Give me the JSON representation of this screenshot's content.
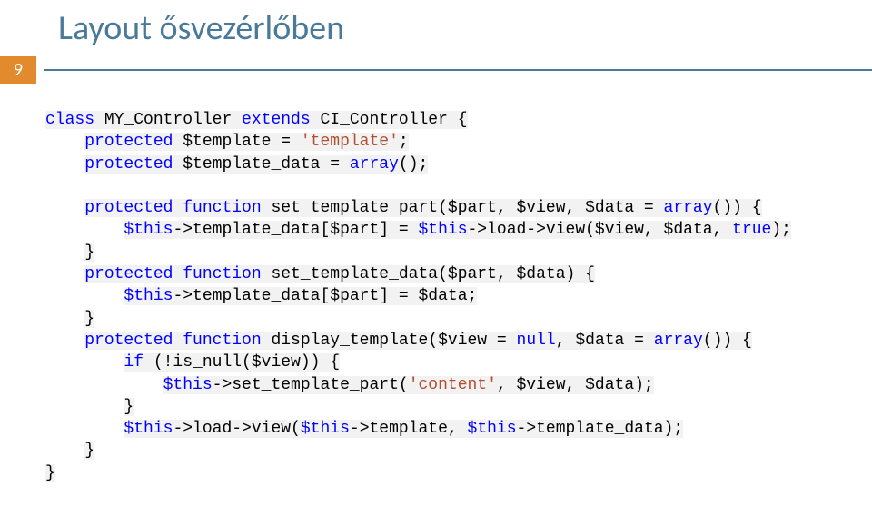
{
  "title": "Layout ősvezérlőben",
  "page_number": "9",
  "code": {
    "l1_a": "class",
    "l1_b": " MY_Controller ",
    "l1_c": "extends",
    "l1_d": " CI_Controller {",
    "l2_a": "protected",
    "l2_b": " $template = ",
    "l2_c": "'template'",
    "l2_d": ";",
    "l3_a": "protected",
    "l3_b": " $template_data = ",
    "l3_c": "array",
    "l3_d": "();",
    "l5_a": "protected function",
    "l5_b": " set_template_part($part, $view, $data = ",
    "l5_c": "array",
    "l5_d": "()) {",
    "l6_a": "$this",
    "l6_b": "->template_data[$part] = ",
    "l6_c": "$this",
    "l6_d": "->load->view($view, $data, ",
    "l6_e": "true",
    "l6_f": ");",
    "l7": "}",
    "l8_a": "protected function",
    "l8_b": " set_template_data($part, $data) {",
    "l9_a": "$this",
    "l9_b": "->template_data[$part] = $data;",
    "l10": "}",
    "l11_a": "protected function",
    "l11_b": " display_template($view = ",
    "l11_c": "null",
    "l11_d": ", $data = ",
    "l11_e": "array",
    "l11_f": "()) {",
    "l12_a": "if",
    "l12_b": " (!is_null($view)) {",
    "l13_a": "$this",
    "l13_b": "->set_template_part(",
    "l13_c": "'content'",
    "l13_d": ", $view, $data);",
    "l14": "}",
    "l15_a": "$this",
    "l15_b": "->load->view(",
    "l15_c": "$this",
    "l15_d": "->template, ",
    "l15_e": "$this",
    "l15_f": "->template_data);",
    "l16": "}",
    "l17": "}"
  }
}
